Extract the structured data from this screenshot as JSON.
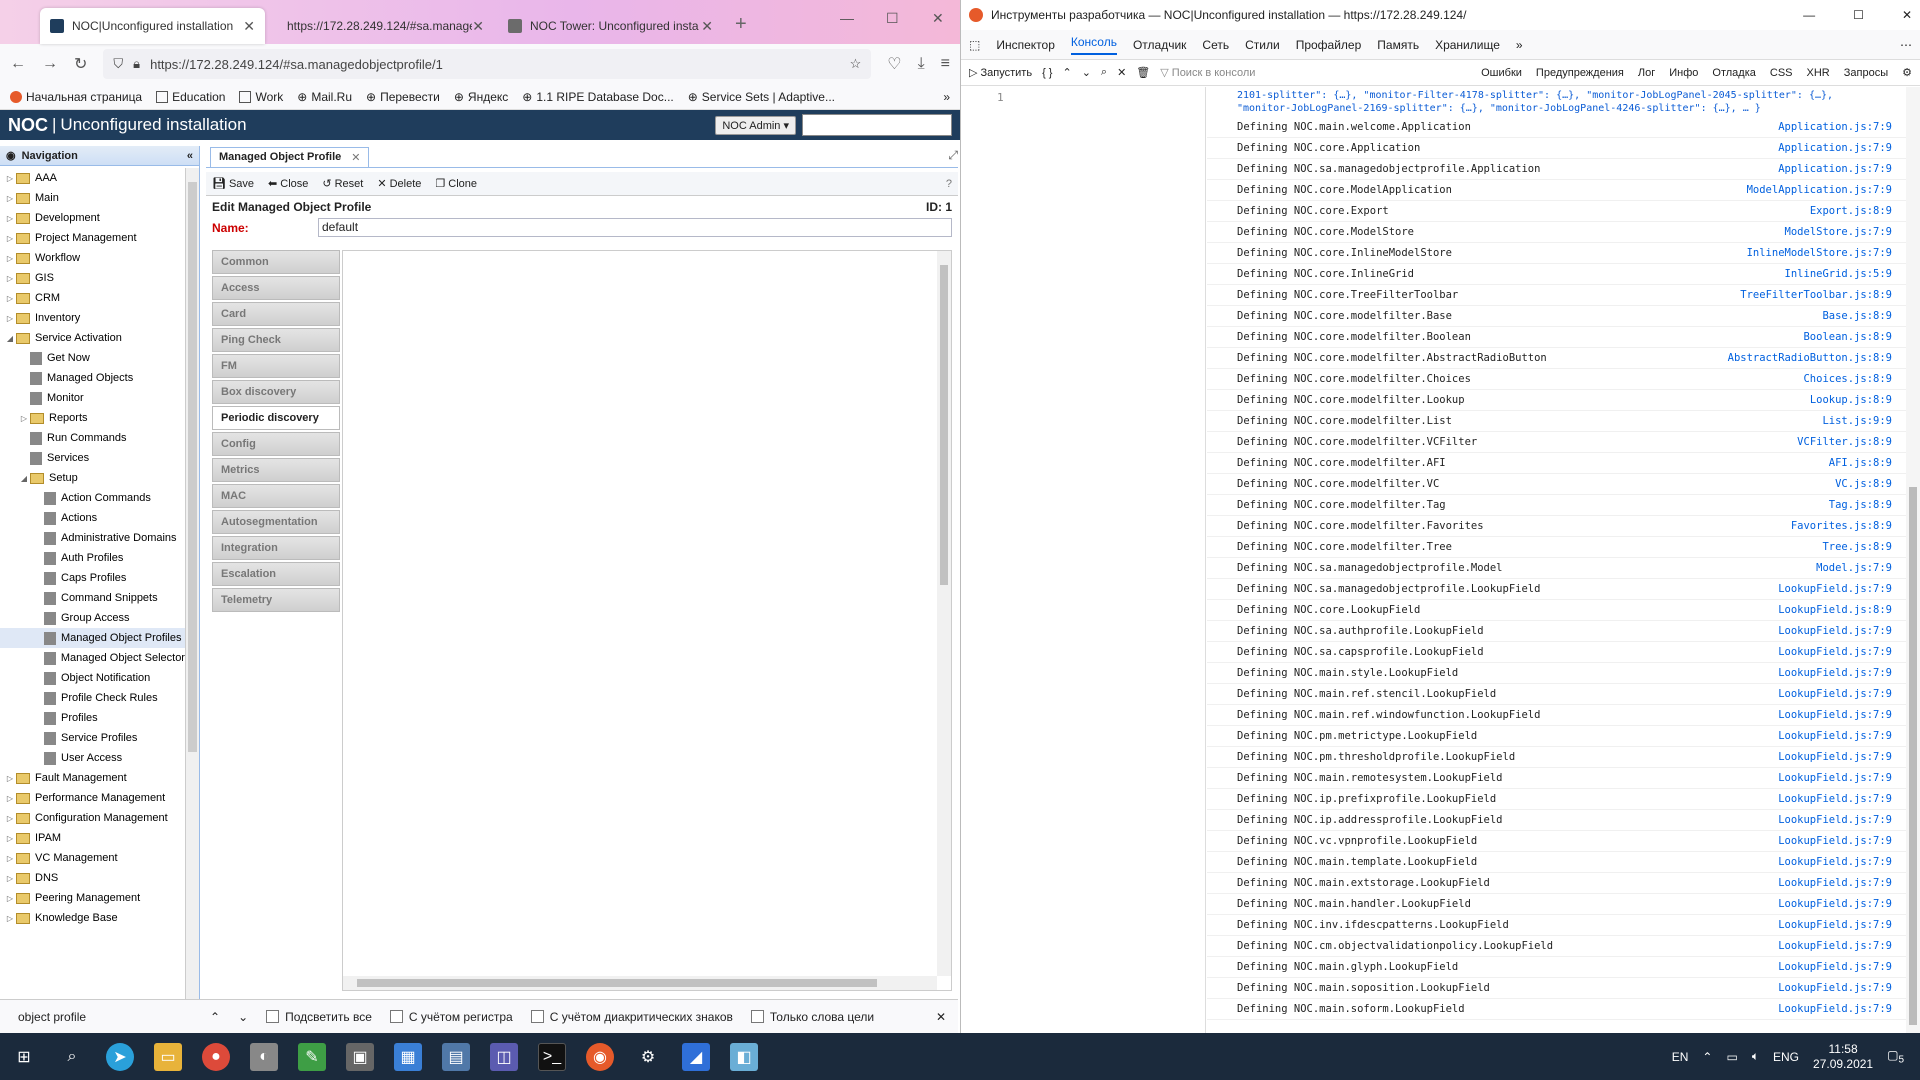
{
  "browser": {
    "tabs": [
      {
        "title": "NOC|Unconfigured installation",
        "active": true,
        "favicon_color": "#1f3d5c"
      },
      {
        "title": "https://172.28.249.124/#sa.manage",
        "active": false,
        "favicon_color": ""
      },
      {
        "title": "NOC Tower: Unconfigured insta",
        "active": false,
        "favicon_color": "#6b6b6b"
      }
    ],
    "url": "https://172.28.249.124/#sa.managedobjectprofile/1",
    "bookmarks": [
      "Начальная страница",
      "Education",
      "Work",
      "Mail.Ru",
      "Перевести",
      "Яндекс",
      "1.1 RIPE Database Doc...",
      "Service Sets | Adaptive..."
    ]
  },
  "noc": {
    "logo": "NOC",
    "title": "Unconfigured installation",
    "user": "NOC Admin",
    "nav_title": "Navigation",
    "tree": [
      {
        "label": "AAA",
        "type": "folder",
        "depth": 0
      },
      {
        "label": "Main",
        "type": "folder",
        "depth": 0
      },
      {
        "label": "Development",
        "type": "folder",
        "depth": 0
      },
      {
        "label": "Project Management",
        "type": "folder",
        "depth": 0
      },
      {
        "label": "Workflow",
        "type": "folder",
        "depth": 0
      },
      {
        "label": "GIS",
        "type": "folder",
        "depth": 0
      },
      {
        "label": "CRM",
        "type": "folder",
        "depth": 0
      },
      {
        "label": "Inventory",
        "type": "folder",
        "depth": 0
      },
      {
        "label": "Service Activation",
        "type": "folder-open",
        "depth": 0
      },
      {
        "label": "Get Now",
        "type": "leaf",
        "depth": 1
      },
      {
        "label": "Managed Objects",
        "type": "leaf",
        "depth": 1
      },
      {
        "label": "Monitor",
        "type": "leaf",
        "depth": 1
      },
      {
        "label": "Reports",
        "type": "folder",
        "depth": 1
      },
      {
        "label": "Run Commands",
        "type": "leaf",
        "depth": 1
      },
      {
        "label": "Services",
        "type": "leaf",
        "depth": 1
      },
      {
        "label": "Setup",
        "type": "folder-open",
        "depth": 1
      },
      {
        "label": "Action Commands",
        "type": "leaf",
        "depth": 2
      },
      {
        "label": "Actions",
        "type": "leaf",
        "depth": 2
      },
      {
        "label": "Administrative Domains",
        "type": "leaf",
        "depth": 2
      },
      {
        "label": "Auth Profiles",
        "type": "leaf",
        "depth": 2
      },
      {
        "label": "Caps Profiles",
        "type": "leaf",
        "depth": 2
      },
      {
        "label": "Command Snippets",
        "type": "leaf",
        "depth": 2
      },
      {
        "label": "Group Access",
        "type": "leaf",
        "depth": 2
      },
      {
        "label": "Managed Object Profiles",
        "type": "leaf",
        "depth": 2,
        "selected": true
      },
      {
        "label": "Managed Object Selector",
        "type": "leaf",
        "depth": 2
      },
      {
        "label": "Object Notification",
        "type": "leaf",
        "depth": 2
      },
      {
        "label": "Profile Check Rules",
        "type": "leaf",
        "depth": 2
      },
      {
        "label": "Profiles",
        "type": "leaf",
        "depth": 2
      },
      {
        "label": "Service Profiles",
        "type": "leaf",
        "depth": 2
      },
      {
        "label": "User Access",
        "type": "leaf",
        "depth": 2
      },
      {
        "label": "Fault Management",
        "type": "folder",
        "depth": 0
      },
      {
        "label": "Performance Management",
        "type": "folder",
        "depth": 0
      },
      {
        "label": "Configuration Management",
        "type": "folder",
        "depth": 0
      },
      {
        "label": "IPAM",
        "type": "folder",
        "depth": 0
      },
      {
        "label": "VC Management",
        "type": "folder",
        "depth": 0
      },
      {
        "label": "DNS",
        "type": "folder",
        "depth": 0
      },
      {
        "label": "Peering Management",
        "type": "folder",
        "depth": 0
      },
      {
        "label": "Knowledge Base",
        "type": "folder",
        "depth": 0
      }
    ],
    "main_tab": "Managed Object Profile",
    "toolbar": {
      "save": "Save",
      "close": "Close",
      "reset": "Reset",
      "delete": "Delete",
      "clone": "Clone"
    },
    "form_title": "Edit Managed Object Profile",
    "form_id": "ID: 1",
    "name_label": "Name:",
    "name_value": "default",
    "sections": [
      "Common",
      "Access",
      "Card",
      "Ping Check",
      "FM",
      "Box discovery",
      "Periodic discovery",
      "Config",
      "Metrics",
      "MAC",
      "Autosegmentation",
      "Integration",
      "Escalation",
      "Telemetry"
    ],
    "active_section": "Periodic discovery"
  },
  "findbar": {
    "query": "object profile",
    "options": [
      "Подсветить все",
      "С учётом регистра",
      "С учётом диакритических знаков",
      "Только слова цели"
    ]
  },
  "devtools": {
    "title": "Инструменты разработчика — NOC|Unconfigured installation — https://172.28.249.124/",
    "tabs": [
      "Инспектор",
      "Консоль",
      "Отладчик",
      "Сеть",
      "Стили",
      "Профайлер",
      "Память",
      "Хранилище"
    ],
    "active_tab": "Консоль",
    "run_label": "Запустить",
    "search_placeholder": "Поиск в консоли",
    "filters": [
      "Ошибки",
      "Предупреждения",
      "Лог",
      "Инфо",
      "Отладка",
      "CSS",
      "XHR",
      "Запросы"
    ],
    "line_number": "1",
    "log_head": "2101-splitter\": {…}, \"monitor-Filter-4178-splitter\": {…}, \"monitor-JobLogPanel-2045-splitter\": {…}, \"monitor-JobLogPanel-2169-splitter\": {…}, \"monitor-JobLogPanel-4246-splitter\": {…}, … }",
    "logs": [
      {
        "msg": "Defining NOC.main.welcome.Application",
        "src": "Application.js:7:9"
      },
      {
        "msg": "Defining NOC.core.Application",
        "src": "Application.js:7:9"
      },
      {
        "msg": "Defining NOC.sa.managedobjectprofile.Application",
        "src": "Application.js:7:9"
      },
      {
        "msg": "Defining NOC.core.ModelApplication",
        "src": "ModelApplication.js:7:9"
      },
      {
        "msg": "Defining NOC.core.Export",
        "src": "Export.js:8:9"
      },
      {
        "msg": "Defining NOC.core.ModelStore",
        "src": "ModelStore.js:7:9"
      },
      {
        "msg": "Defining NOC.core.InlineModelStore",
        "src": "InlineModelStore.js:7:9"
      },
      {
        "msg": "Defining NOC.core.InlineGrid",
        "src": "InlineGrid.js:5:9"
      },
      {
        "msg": "Defining NOC.core.TreeFilterToolbar",
        "src": "TreeFilterToolbar.js:8:9"
      },
      {
        "msg": "Defining NOC.core.modelfilter.Base",
        "src": "Base.js:8:9"
      },
      {
        "msg": "Defining NOC.core.modelfilter.Boolean",
        "src": "Boolean.js:8:9"
      },
      {
        "msg": "Defining NOC.core.modelfilter.AbstractRadioButton",
        "src": "AbstractRadioButton.js:8:9"
      },
      {
        "msg": "Defining NOC.core.modelfilter.Choices",
        "src": "Choices.js:8:9"
      },
      {
        "msg": "Defining NOC.core.modelfilter.Lookup",
        "src": "Lookup.js:8:9"
      },
      {
        "msg": "Defining NOC.core.modelfilter.List",
        "src": "List.js:9:9"
      },
      {
        "msg": "Defining NOC.core.modelfilter.VCFilter",
        "src": "VCFilter.js:8:9"
      },
      {
        "msg": "Defining NOC.core.modelfilter.AFI",
        "src": "AFI.js:8:9"
      },
      {
        "msg": "Defining NOC.core.modelfilter.VC",
        "src": "VC.js:8:9"
      },
      {
        "msg": "Defining NOC.core.modelfilter.Tag",
        "src": "Tag.js:8:9"
      },
      {
        "msg": "Defining NOC.core.modelfilter.Favorites",
        "src": "Favorites.js:8:9"
      },
      {
        "msg": "Defining NOC.core.modelfilter.Tree",
        "src": "Tree.js:8:9"
      },
      {
        "msg": "Defining NOC.sa.managedobjectprofile.Model",
        "src": "Model.js:7:9"
      },
      {
        "msg": "Defining NOC.sa.managedobjectprofile.LookupField",
        "src": "LookupField.js:7:9"
      },
      {
        "msg": "Defining NOC.core.LookupField",
        "src": "LookupField.js:8:9"
      },
      {
        "msg": "Defining NOC.sa.authprofile.LookupField",
        "src": "LookupField.js:7:9"
      },
      {
        "msg": "Defining NOC.sa.capsprofile.LookupField",
        "src": "LookupField.js:7:9"
      },
      {
        "msg": "Defining NOC.main.style.LookupField",
        "src": "LookupField.js:7:9"
      },
      {
        "msg": "Defining NOC.main.ref.stencil.LookupField",
        "src": "LookupField.js:7:9"
      },
      {
        "msg": "Defining NOC.main.ref.windowfunction.LookupField",
        "src": "LookupField.js:7:9"
      },
      {
        "msg": "Defining NOC.pm.metrictype.LookupField",
        "src": "LookupField.js:7:9"
      },
      {
        "msg": "Defining NOC.pm.thresholdprofile.LookupField",
        "src": "LookupField.js:7:9"
      },
      {
        "msg": "Defining NOC.main.remotesystem.LookupField",
        "src": "LookupField.js:7:9"
      },
      {
        "msg": "Defining NOC.ip.prefixprofile.LookupField",
        "src": "LookupField.js:7:9"
      },
      {
        "msg": "Defining NOC.ip.addressprofile.LookupField",
        "src": "LookupField.js:7:9"
      },
      {
        "msg": "Defining NOC.vc.vpnprofile.LookupField",
        "src": "LookupField.js:7:9"
      },
      {
        "msg": "Defining NOC.main.template.LookupField",
        "src": "LookupField.js:7:9"
      },
      {
        "msg": "Defining NOC.main.extstorage.LookupField",
        "src": "LookupField.js:7:9"
      },
      {
        "msg": "Defining NOC.main.handler.LookupField",
        "src": "LookupField.js:7:9"
      },
      {
        "msg": "Defining NOC.inv.ifdescpatterns.LookupField",
        "src": "LookupField.js:7:9"
      },
      {
        "msg": "Defining NOC.cm.objectvalidationpolicy.LookupField",
        "src": "LookupField.js:7:9"
      },
      {
        "msg": "Defining NOC.main.glyph.LookupField",
        "src": "LookupField.js:7:9"
      },
      {
        "msg": "Defining NOC.main.soposition.LookupField",
        "src": "LookupField.js:7:9"
      },
      {
        "msg": "Defining NOC.main.soform.LookupField",
        "src": "LookupField.js:7:9"
      }
    ]
  },
  "taskbar": {
    "lang": "EN",
    "lang2": "ENG",
    "time": "11:58",
    "date": "27.09.2021",
    "notifications": "5"
  }
}
